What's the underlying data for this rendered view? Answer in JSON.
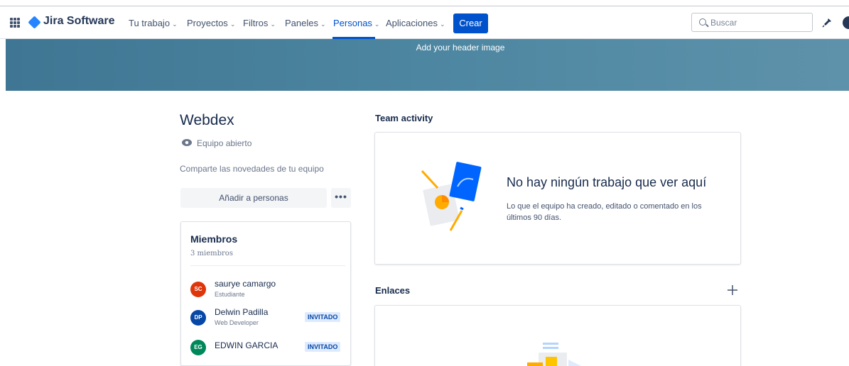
{
  "nav": {
    "product": "Jira Software",
    "items": [
      {
        "label": "Tu trabajo",
        "chevron": "⌄"
      },
      {
        "label": "Proyectos",
        "chevron": "⌄"
      },
      {
        "label": "Filtros",
        "chevron": "⌄"
      },
      {
        "label": "Paneles",
        "chevron": "⌄"
      },
      {
        "label": "Personas",
        "chevron": "⌄",
        "active": true
      },
      {
        "label": "Aplicaciones",
        "chevron": "⌄"
      }
    ],
    "create_label": "Crear",
    "search_placeholder": "Buscar",
    "accent": "#0052cc"
  },
  "banner": {
    "text": "Add your header image",
    "color": "#4a82a0"
  },
  "team": {
    "name": "Webdex",
    "type": "Equipo abierto",
    "description_placeholder": "Comparte las novedades de tu equipo",
    "add_people_label": "Añadir a personas",
    "more_label": "•••"
  },
  "members": {
    "title": "Miembros",
    "count_label": "3 miembros",
    "list": [
      {
        "initials": "SC",
        "name": "saurye camargo",
        "role": "Estudiante",
        "badge": "",
        "color": "#de350b"
      },
      {
        "initials": "DP",
        "name": "Delwin Padilla",
        "role": "Web Developer",
        "badge": "INVITADO",
        "color": "#0747a6"
      },
      {
        "initials": "EG",
        "name": "EDWIN GARCIA",
        "role": "",
        "badge": "INVITADO",
        "color": "#00875a"
      }
    ]
  },
  "activity": {
    "title": "Team activity",
    "empty_title": "No hay ningún trabajo que ver aquí",
    "empty_desc": "Lo que el equipo ha creado, editado o comentado en los últimos 90 días."
  },
  "links": {
    "title": "Enlaces"
  },
  "icons": [
    "app-switcher-icon",
    "jira-logo-icon",
    "search-icon",
    "notification-icon",
    "eye-icon",
    "plus-icon"
  ]
}
